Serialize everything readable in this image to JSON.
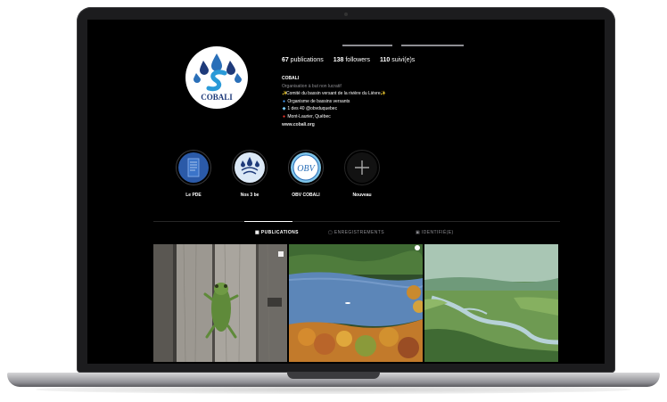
{
  "profile": {
    "posts_count": "67",
    "posts_label": "publications",
    "followers_count": "138",
    "followers_label": "followers",
    "following_count": "110",
    "following_label": "suivi(e)s",
    "avatar_text": "COBALI"
  },
  "bio": {
    "name": "COBALI",
    "category": "Organisation à but non lucratif",
    "line1": "Comité du bassin versant de la rivière du Lièvre",
    "line2": "Organisme de bassins versants",
    "line3": "1 des 40 @obvduquebec",
    "line4": "Mont-Laurier, Québec",
    "website": "www.cobali.org"
  },
  "highlights": [
    {
      "label": "Le PDE",
      "icon": "document-icon"
    },
    {
      "label": "Nos 3 be",
      "icon": "cobali-logo-icon"
    },
    {
      "label": "OBV COBALI",
      "icon": "obv-logo-icon"
    },
    {
      "label": "Nouveau",
      "icon": "plus-icon"
    }
  ],
  "tabs": {
    "publications": "PUBLICATIONS",
    "saved": "ENREGISTREMENTS",
    "tagged": "IDENTIFIÉ(E)"
  },
  "posts": [
    {
      "subject": "frog-on-wood-photo"
    },
    {
      "subject": "lake-autumn-photo"
    },
    {
      "subject": "river-valley-photo"
    }
  ],
  "colors": {
    "screen_bg": "#000000",
    "text": "#ffffff",
    "muted": "#8e8e93",
    "cobali_blue": "#2a6fb8",
    "cobali_navy": "#1e3a7a"
  }
}
